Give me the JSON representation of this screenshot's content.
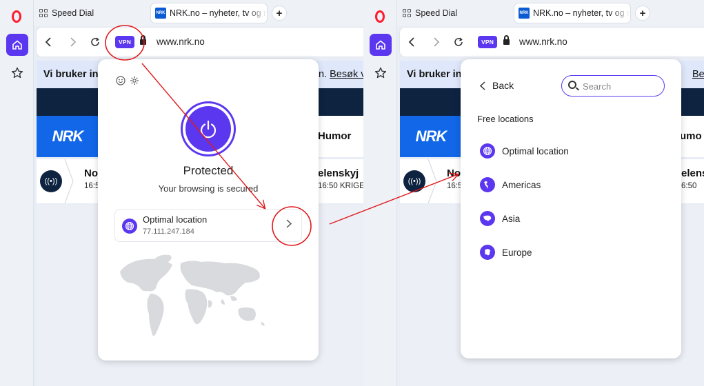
{
  "left": {
    "tabs": {
      "speed_dial": "Speed Dial",
      "active_title": "NRK.no – nyheter, tv og radio",
      "favicon_text": "NRK"
    },
    "address": {
      "vpn_label": "VPN",
      "url": "www.nrk.no"
    },
    "page": {
      "infobar_text": "Vi bruker inf",
      "infobar_tail": "n.",
      "infobar_link": "Besøk v",
      "nrk_logo": "NRK",
      "humor": "Humor",
      "news_title_left": "No",
      "news_time_left": "16:5",
      "news_title_right": "elenskyj",
      "news_sub_right": "16:50 KRIGE"
    },
    "vpn_popup": {
      "status": "Protected",
      "status_sub": "Your browsing is secured",
      "location_name": "Optimal location",
      "location_ip": "77.111.247.184"
    }
  },
  "right": {
    "tabs": {
      "speed_dial": "Speed Dial",
      "active_title": "NRK.no – nyheter, tv og radio",
      "favicon_text": "NRK"
    },
    "address": {
      "vpn_label": "VPN",
      "url": "www.nrk.no"
    },
    "page": {
      "infobar_text": "Vi bruker inf",
      "infobar_link": "Be",
      "nrk_logo": "NRK",
      "humor": "umo",
      "news_title_left": "No",
      "news_time_left": "16:5",
      "news_title_right": "elens",
      "news_sub_right": "6:50"
    },
    "locations_popup": {
      "back_label": "Back",
      "search_placeholder": "Search",
      "section_title": "Free locations",
      "items": [
        "Optimal location",
        "Americas",
        "Asia",
        "Europe"
      ]
    }
  },
  "colors": {
    "accent": "#5b37f0",
    "annotation": "#e0191b",
    "nrk_blue": "#1167e8",
    "navy": "#0d2340",
    "opera_red": "#ff1b2d"
  },
  "icons": [
    "opera-logo-icon",
    "home-icon",
    "star-icon",
    "grid-icon",
    "back-arrow-icon",
    "forward-arrow-icon",
    "reload-icon",
    "lock-icon",
    "power-icon",
    "smiley-icon",
    "gear-icon",
    "globe-icon",
    "chevron-right-icon",
    "chevron-left-icon",
    "search-icon",
    "live-radio-icon"
  ]
}
